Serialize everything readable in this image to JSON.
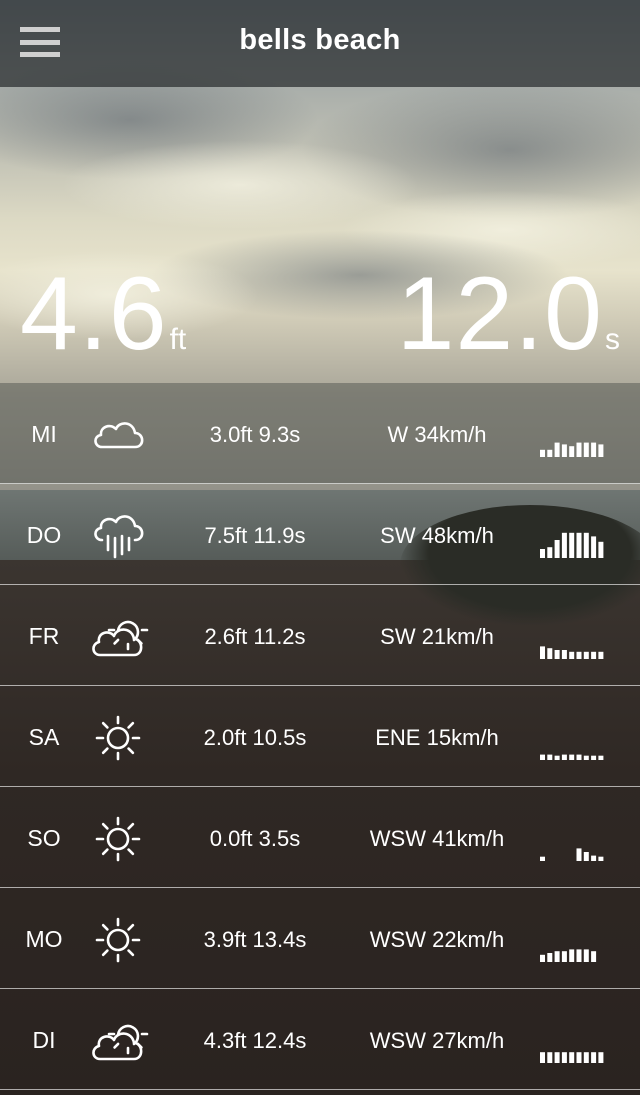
{
  "header": {
    "title": "bells beach",
    "menu_icon": "hamburger-menu-icon"
  },
  "hero": {
    "wave_height": "4.6",
    "wave_height_unit": "ft",
    "wave_period": "12.0",
    "wave_period_unit": "s"
  },
  "forecast": [
    {
      "day": "MI",
      "icon": "cloud-icon",
      "swell": "3.0ft 9.3s",
      "wind": "W 34km/h",
      "bars": [
        0.2,
        0.2,
        0.4,
        0.35,
        0.3,
        0.4,
        0.4,
        0.4,
        0.35
      ]
    },
    {
      "day": "DO",
      "icon": "rain-icon",
      "swell": "7.5ft 11.9s",
      "wind": "SW 48km/h",
      "bars": [
        0.25,
        0.3,
        0.5,
        0.7,
        0.7,
        0.7,
        0.7,
        0.6,
        0.45
      ]
    },
    {
      "day": "FR",
      "icon": "partly-cloudy-icon",
      "swell": "2.6ft 11.2s",
      "wind": "SW 21km/h",
      "bars": [
        0.35,
        0.3,
        0.25,
        0.25,
        0.2,
        0.2,
        0.2,
        0.2,
        0.2
      ]
    },
    {
      "day": "SA",
      "icon": "sun-icon",
      "swell": "2.0ft 10.5s",
      "wind": "ENE 15km/h",
      "bars": [
        0.15,
        0.15,
        0.12,
        0.15,
        0.15,
        0.15,
        0.12,
        0.12,
        0.12
      ]
    },
    {
      "day": "SO",
      "icon": "sun-icon",
      "swell": "0.0ft 3.5s",
      "wind": "WSW 41km/h",
      "bars": [
        0.12,
        0.0,
        0.0,
        0.0,
        0.0,
        0.35,
        0.25,
        0.15,
        0.12
      ]
    },
    {
      "day": "MO",
      "icon": "sun-icon",
      "swell": "3.9ft 13.4s",
      "wind": "WSW 22km/h",
      "bars": [
        0.2,
        0.25,
        0.3,
        0.3,
        0.35,
        0.35,
        0.35,
        0.3,
        0.0
      ]
    },
    {
      "day": "DI",
      "icon": "partly-cloudy-icon",
      "swell": "4.3ft 12.4s",
      "wind": "WSW 27km/h",
      "bars": [
        0.3,
        0.3,
        0.3,
        0.3,
        0.3,
        0.3,
        0.3,
        0.3,
        0.3
      ]
    }
  ]
}
